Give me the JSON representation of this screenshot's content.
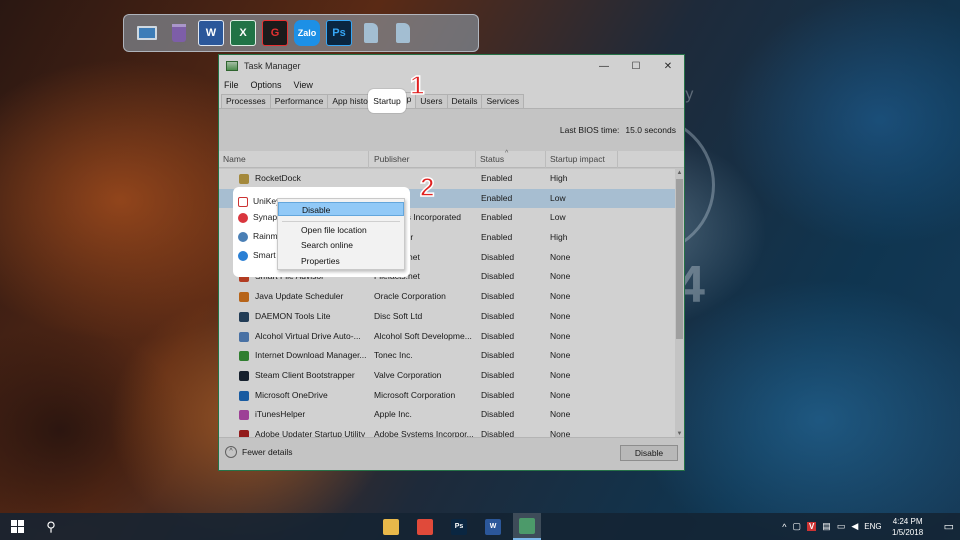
{
  "dock": {
    "icons": [
      "computer-icon",
      "recycle-bin-icon",
      "word-icon",
      "excel-icon",
      "garena-icon",
      "zalo-icon",
      "photoshop-icon",
      "document-icon",
      "document-icon"
    ],
    "word_glyph": "W",
    "excel_glyph": "X",
    "garena_glyph": "G",
    "zalo_glyph": "Zalo",
    "ps_glyph": "Ps"
  },
  "window": {
    "title": "Task Manager",
    "min_glyph": "—",
    "max_glyph": "☐",
    "close_glyph": "✕",
    "menu": [
      "File",
      "Options",
      "View"
    ],
    "tabs": [
      "Processes",
      "Performance",
      "App history",
      "Startup",
      "Users",
      "Details",
      "Services"
    ],
    "active_tab": "Startup",
    "bios_label": "Last BIOS time:",
    "bios_value": "15.0 seconds",
    "columns": [
      "Name",
      "Publisher",
      "Status",
      "Startup impact"
    ],
    "sort_glyph": "^",
    "rows": [
      {
        "name": "RocketDock",
        "publisher": "",
        "status": "Enabled",
        "impact": "High",
        "icon_color": "#c9a84a"
      },
      {
        "name": "UniKeyNT",
        "publisher": "",
        "status": "Enabled",
        "impact": "Low",
        "icon_color": "#cc3333"
      },
      {
        "name": "Synaptics",
        "publisher": "Synaptics Incorporated",
        "status": "Enabled",
        "impact": "Low",
        "icon_color": "#d9363e"
      },
      {
        "name": "Rainmeter",
        "publisher": "Rainmeter",
        "status": "Enabled",
        "impact": "High",
        "icon_color": "#4a7fb5"
      },
      {
        "name": "Smart File Advisor",
        "publisher": "Filefacts.net",
        "status": "Disabled",
        "impact": "None",
        "icon_color": "#2a7fd4"
      },
      {
        "name": "Smart File Advisor",
        "publisher": "Filefacts.net",
        "status": "Disabled",
        "impact": "None",
        "icon_color": "#d94a2a"
      },
      {
        "name": "Java Update Scheduler",
        "publisher": "Oracle Corporation",
        "status": "Disabled",
        "impact": "None",
        "icon_color": "#e07a1f"
      },
      {
        "name": "DAEMON Tools Lite",
        "publisher": "Disc Soft Ltd",
        "status": "Disabled",
        "impact": "None",
        "icon_color": "#2a4a6a"
      },
      {
        "name": "Alcohol Virtual Drive Auto-...",
        "publisher": "Alcohol Soft Developme...",
        "status": "Disabled",
        "impact": "None",
        "icon_color": "#5a8ac9"
      },
      {
        "name": "Internet Download Manager...",
        "publisher": "Tonec Inc.",
        "status": "Disabled",
        "impact": "None",
        "icon_color": "#3a9a3a"
      },
      {
        "name": "Steam Client Bootstrapper",
        "publisher": "Valve Corporation",
        "status": "Disabled",
        "impact": "None",
        "icon_color": "#1b2838"
      },
      {
        "name": "Microsoft OneDrive",
        "publisher": "Microsoft Corporation",
        "status": "Disabled",
        "impact": "None",
        "icon_color": "#1f6fc5"
      },
      {
        "name": "iTunesHelper",
        "publisher": "Apple Inc.",
        "status": "Disabled",
        "impact": "None",
        "icon_color": "#c04fb8"
      },
      {
        "name": "Adobe Updater Startup Utility",
        "publisher": "Adobe Systems Incorpor...",
        "status": "Disabled",
        "impact": "None",
        "icon_color": "#b32020"
      }
    ],
    "fewer_details": "Fewer details",
    "fewer_glyph": "^",
    "disable_button": "Disable",
    "sb_up_glyph": "▲",
    "sb_down_glyph": "▼"
  },
  "callout": {
    "step1": "1",
    "step2": "2",
    "highlight_tab": "Startup",
    "selected_row": "UniKeyNT",
    "side_rows": [
      "Synap",
      "Rainm",
      "Smart"
    ],
    "context_menu": {
      "items": [
        "Disable",
        "Open file location",
        "Search online",
        "Properties"
      ],
      "hovered": "Disable"
    }
  },
  "desktop": {
    "ghost_text": "ry",
    "ghost_number": "4"
  },
  "taskbar": {
    "search_glyph": "⚲",
    "apps": [
      {
        "name": "file-explorer-icon",
        "glyph": "",
        "color": "#e8b84a"
      },
      {
        "name": "chrome-icon",
        "glyph": "",
        "color": "#e04a3a"
      },
      {
        "name": "photoshop-taskbar-icon",
        "glyph": "Ps",
        "color": "#0a2641"
      },
      {
        "name": "word-taskbar-icon",
        "glyph": "W",
        "color": "#2b579a"
      },
      {
        "name": "task-manager-taskbar-icon",
        "glyph": "",
        "color": "#4c9a6a"
      }
    ],
    "tray": {
      "up_glyph": "^",
      "unikey": "V",
      "lang": "ENG",
      "time": "4:24 PM",
      "date": "1/5/2018",
      "notif_glyph": "▭",
      "speaker_glyph": "◀",
      "network_glyph": "▤",
      "battery_glyph": "▭",
      "folder_glyph": "▢"
    }
  }
}
